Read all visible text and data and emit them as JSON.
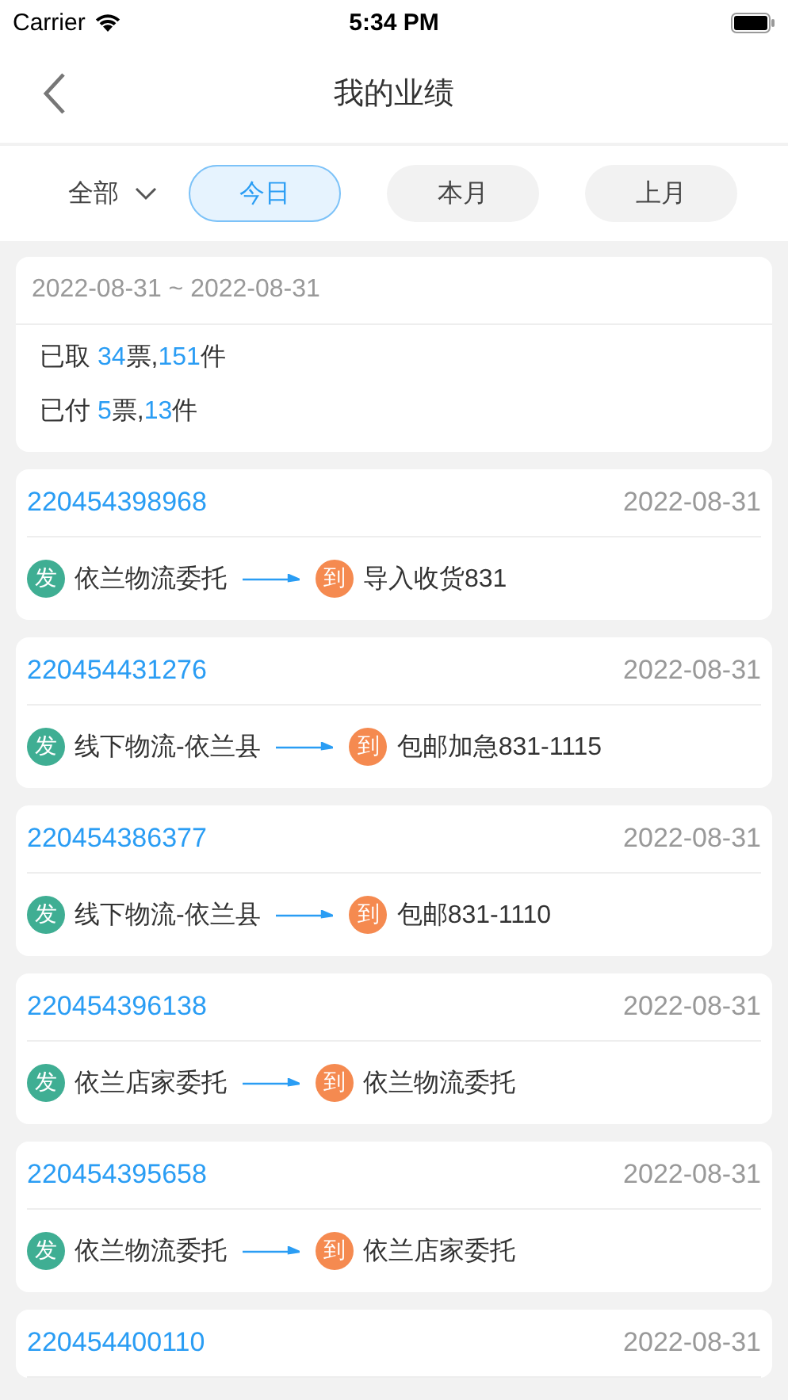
{
  "status_bar": {
    "carrier": "Carrier",
    "time": "5:34 PM"
  },
  "nav": {
    "title": "我的业绩"
  },
  "filter": {
    "dropdown": "全部",
    "tabs": [
      {
        "label": "今日",
        "selected": true
      },
      {
        "label": "本月",
        "selected": false
      },
      {
        "label": "上月",
        "selected": false
      }
    ]
  },
  "summary": {
    "date_range": "2022-08-31 ~ 2022-08-31",
    "lines": [
      [
        {
          "text": "已取 ",
          "highlight": false
        },
        {
          "text": "34",
          "highlight": true
        },
        {
          "text": "票,",
          "highlight": false
        },
        {
          "text": "151",
          "highlight": true
        },
        {
          "text": "件",
          "highlight": false
        }
      ],
      [
        {
          "text": "已付 ",
          "highlight": false
        },
        {
          "text": "5",
          "highlight": true
        },
        {
          "text": "票,",
          "highlight": false
        },
        {
          "text": "13",
          "highlight": true
        },
        {
          "text": "件",
          "highlight": false
        }
      ]
    ]
  },
  "orders": [
    {
      "number": "220454398968",
      "date": "2022-08-31",
      "from_badge": "发",
      "from": "依兰物流委托",
      "to_badge": "到",
      "to": "导入收货831"
    },
    {
      "number": "220454431276",
      "date": "2022-08-31",
      "from_badge": "发",
      "from": "线下物流-依兰县",
      "to_badge": "到",
      "to": "包邮加急831-1115"
    },
    {
      "number": "220454386377",
      "date": "2022-08-31",
      "from_badge": "发",
      "from": "线下物流-依兰县",
      "to_badge": "到",
      "to": "包邮831-1110"
    },
    {
      "number": "220454396138",
      "date": "2022-08-31",
      "from_badge": "发",
      "from": "依兰店家委托",
      "to_badge": "到",
      "to": "依兰物流委托"
    },
    {
      "number": "220454395658",
      "date": "2022-08-31",
      "from_badge": "发",
      "from": "依兰物流委托",
      "to_badge": "到",
      "to": "依兰店家委托"
    },
    {
      "number": "220454400110",
      "date": "2022-08-31"
    }
  ]
}
